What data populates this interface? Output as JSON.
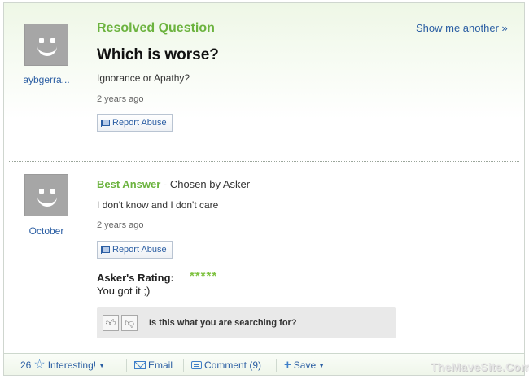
{
  "question": {
    "status": "Resolved Question",
    "show_another": "Show me another »",
    "title": "Which is worse?",
    "body": "Ignorance or Apathy?",
    "time_ago": "2 years ago",
    "report": "Report Abuse",
    "asker": "aybgerra..."
  },
  "answer": {
    "best_label": "Best Answer",
    "chosen_by": " - Chosen by Asker",
    "body": "I don't know and I don't care",
    "time_ago": "2 years ago",
    "report": "Report Abuse",
    "answerer": "October",
    "rating_label": "Asker's Rating:",
    "stars": "*****",
    "rating_value": 5,
    "rating_comment": "You got it ;)"
  },
  "search_prompt": {
    "thumb_up_icon": "thumb-up-icon",
    "thumb_down_icon": "thumb-down-icon",
    "question": "Is this what you are searching for?"
  },
  "toolbar": {
    "interesting_count": "26",
    "interesting_label": "Interesting!",
    "email_label": "Email",
    "comment_label": "Comment (9)",
    "save_label": "Save"
  },
  "watermark": "TheMaveSite.Com",
  "colors": {
    "green": "#6cb33f",
    "link": "#2b5ea3",
    "star": "#7fc241"
  }
}
